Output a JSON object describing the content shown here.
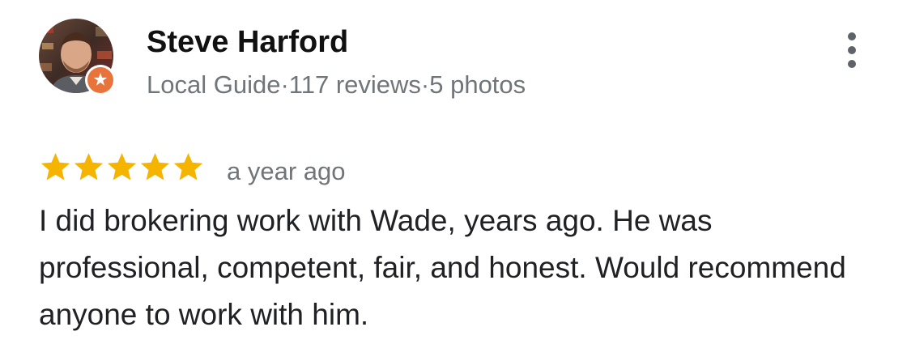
{
  "reviewer": {
    "name": "Steve Harford",
    "badge": "Local Guide",
    "separator_1": "·",
    "reviews": "117 reviews",
    "separator_2": "·",
    "photos": "5 photos",
    "avatar_icon": "user-photo",
    "badge_icon": "local-guide-star-icon"
  },
  "review": {
    "rating": 5,
    "rating_max": 5,
    "date": "a year ago",
    "text": "I did brokering work with Wade, years ago. He was professional, competent, fair, and honest. Would recommend anyone to work with him."
  },
  "menu": {
    "icon": "more-vert-icon"
  },
  "colors": {
    "star": "#f4b400",
    "badge": "#e8743b",
    "name": "#111111",
    "meta": "#70757a",
    "body": "#202124"
  }
}
